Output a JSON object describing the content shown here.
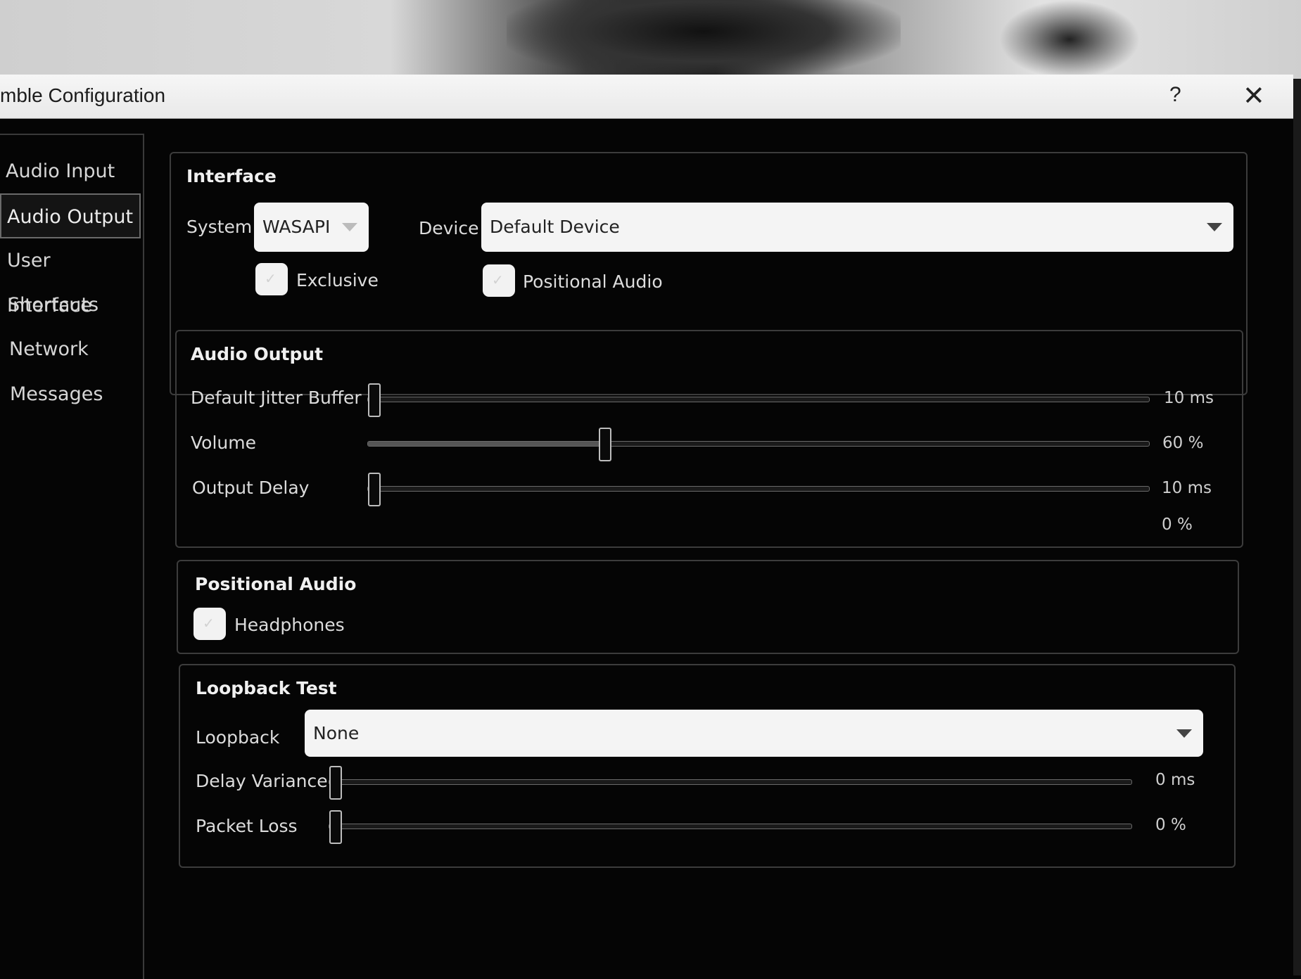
{
  "window": {
    "title": "mble Configuration",
    "help_label": "?",
    "close_label": "✕"
  },
  "sidebar": {
    "items": [
      {
        "label": "Audio Input"
      },
      {
        "label": "Audio Output",
        "active": true
      },
      {
        "label": "User Interface"
      },
      {
        "label": "Shortcuts"
      },
      {
        "label": "Network"
      },
      {
        "label": "Messages"
      }
    ]
  },
  "interface": {
    "title": "Interface",
    "system_label": "System",
    "system_value": "WASAPI",
    "device_label": "Device",
    "device_value": "Default Device",
    "exclusive_label": "Exclusive",
    "exclusive_checked": false,
    "positional_label": "Positional Audio",
    "positional_checked": false
  },
  "audio_output": {
    "title": "Audio Output",
    "jitter_label": "Default Jitter Buffer",
    "jitter_value": "10 ms",
    "jitter_fraction": 0.0,
    "volume_label": "Volume",
    "volume_value": "60 %",
    "volume_fraction": 0.3,
    "delay_label": "Output Delay",
    "delay_value": "10 ms",
    "delay_fraction": 0.0,
    "extra_value": "0 %"
  },
  "positional_audio": {
    "title": "Positional Audio",
    "headphones_label": "Headphones",
    "headphones_checked": false
  },
  "loopback": {
    "title": "Loopback Test",
    "loopback_label": "Loopback",
    "loopback_value": "None",
    "variance_label": "Delay Variance",
    "variance_value": "0 ms",
    "variance_fraction": 0.0,
    "loss_label": "Packet Loss",
    "loss_value": "0 %",
    "loss_fraction": 0.0
  }
}
